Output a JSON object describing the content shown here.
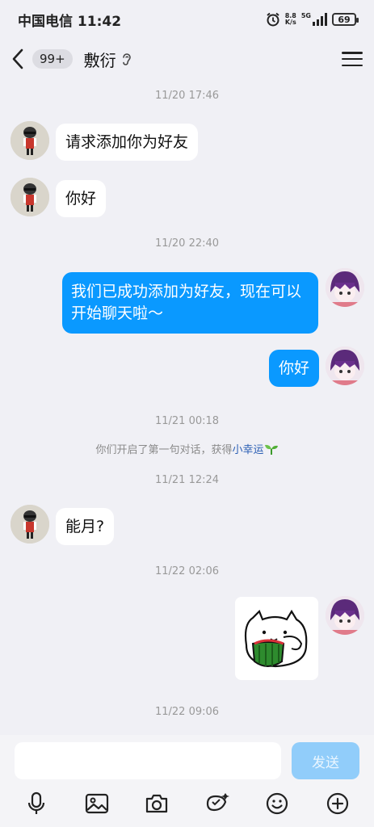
{
  "status": {
    "carrier_time": "中国电信 11:42",
    "speed_top": "8.8",
    "speed_unit": "K/s",
    "network": "5G",
    "battery": "69"
  },
  "header": {
    "unread_badge": "99+",
    "title": "敷衍"
  },
  "messages": {
    "ts1": "11/20 17:46",
    "m1": "请求添加你为好友",
    "m2": "你好",
    "ts2": "11/20 22:40",
    "m3_line1": "我们已成功添加为好友，现在可以",
    "m3_line2": "开始聊天啦～",
    "m4": "你好",
    "ts3": "11/21 00:18",
    "sys1_text": "你们开启了第一句对话，获得",
    "sys1_link": "小幸运",
    "ts4": "11/21 12:24",
    "m5": "能月?",
    "ts5": "11/22 02:06",
    "ts6": "11/22 09:06"
  },
  "input": {
    "placeholder": "",
    "send_label": "发送"
  },
  "icons": {
    "back": "chevron-left-icon",
    "ear": "ear-icon",
    "menu": "menu-icon",
    "voice": "microphone-icon",
    "image": "image-icon",
    "camera": "camera-icon",
    "redpacket": "red-packet-icon",
    "emoji": "emoji-icon",
    "plus": "plus-circle-icon"
  },
  "colors": {
    "bubble_out": "#0a99ff",
    "send_disabled": "#91cdfa",
    "link": "#2b5fb4"
  }
}
